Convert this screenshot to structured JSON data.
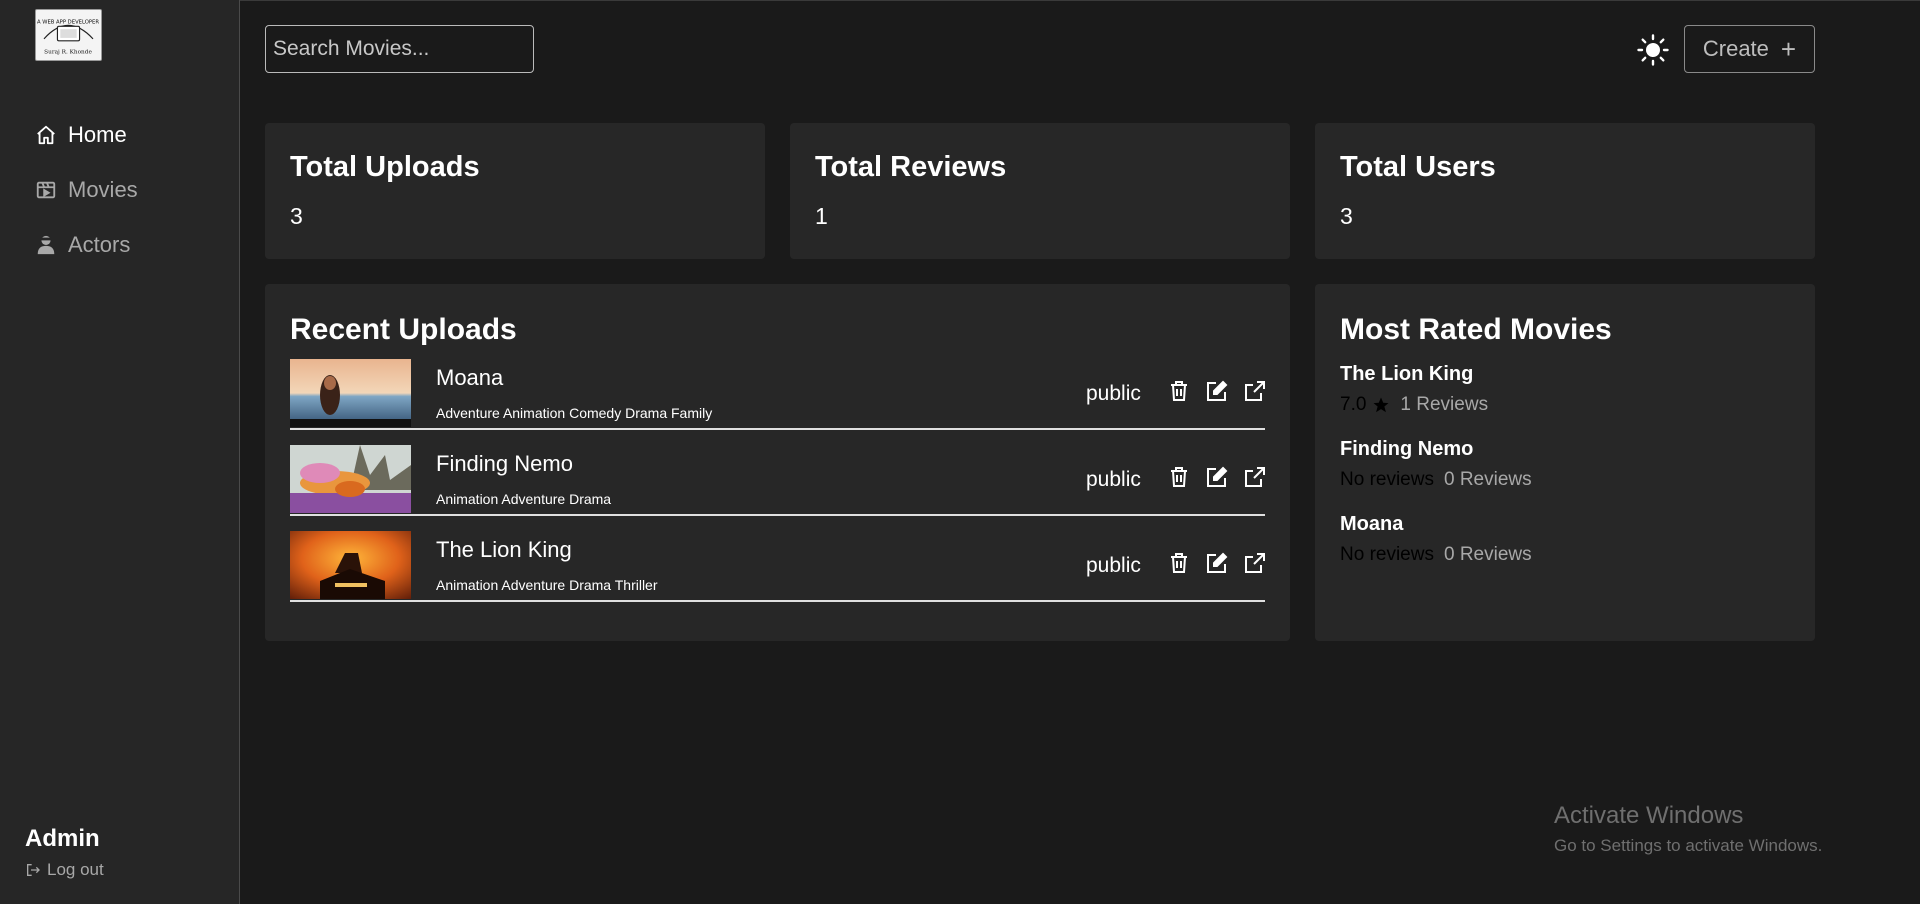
{
  "brand": {
    "logo_text_top": "A WEB APP DEVELOPER",
    "logo_text_bottom": "Suraj R. Khonde"
  },
  "sidebar": {
    "items": [
      {
        "label": "Home",
        "icon": "home-icon",
        "active": true
      },
      {
        "label": "Movies",
        "icon": "film-icon",
        "active": false
      },
      {
        "label": "Actors",
        "icon": "user-icon",
        "active": false
      }
    ],
    "user": "Admin",
    "logout": "Log out"
  },
  "header": {
    "search_placeholder": "Search Movies...",
    "create_label": "Create",
    "theme_icon": "sun-icon"
  },
  "stats": [
    {
      "title": "Total Uploads",
      "value": "3"
    },
    {
      "title": "Total Reviews",
      "value": "1"
    },
    {
      "title": "Total Users",
      "value": "3"
    }
  ],
  "recent": {
    "title": "Recent Uploads",
    "items": [
      {
        "title": "Moana",
        "genres": "Adventure Animation Comedy Drama Family",
        "status": "public"
      },
      {
        "title": "Finding Nemo",
        "genres": "Animation Adventure Drama",
        "status": "public"
      },
      {
        "title": "The Lion King",
        "genres": "Animation Adventure Drama Thriller",
        "status": "public"
      }
    ]
  },
  "most_rated": {
    "title": "Most Rated Movies",
    "items": [
      {
        "title": "The Lion King",
        "score": "7.0",
        "reviews": "1 Reviews",
        "has_star": true
      },
      {
        "title": "Finding Nemo",
        "score": "No reviews",
        "reviews": "0 Reviews",
        "has_star": false
      },
      {
        "title": "Moana",
        "score": "No reviews",
        "reviews": "0 Reviews",
        "has_star": false
      }
    ]
  },
  "watermark": {
    "line1": "Activate Windows",
    "line2": "Go to Settings to activate Windows."
  },
  "colors": {
    "background": "#1a1a1a",
    "sidebar": "#262626",
    "card": "#272727",
    "text": "#ffffff",
    "muted": "#a8a8a8"
  }
}
